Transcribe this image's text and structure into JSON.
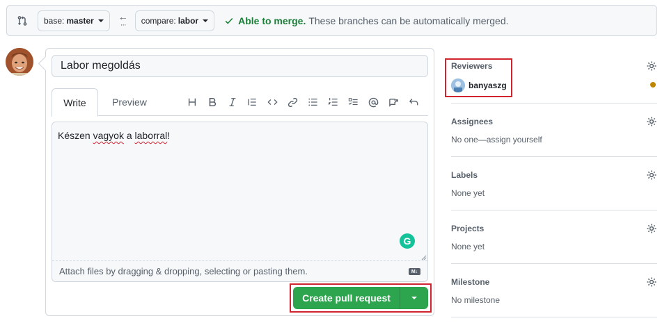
{
  "compare": {
    "base_prefix": "base:",
    "base_branch": "master",
    "compare_prefix": "compare:",
    "compare_branch": "labor",
    "merge_status": "Able to merge.",
    "merge_detail": "These branches can be automatically merged.",
    "status_color": "#1a7f37"
  },
  "pr": {
    "title_value": "Labor megoldás",
    "tabs": [
      "Write",
      "Preview"
    ],
    "toolbar_icons": [
      "heading-icon",
      "bold-icon",
      "italic-icon",
      "quote-icon",
      "code-icon",
      "link-icon",
      "unordered-list-icon",
      "ordered-list-icon",
      "task-list-icon",
      "mention-icon",
      "cross-reference-icon",
      "undo-icon"
    ],
    "body_prefix": "Készen ",
    "body_word1": "vagyok",
    "body_mid": " a ",
    "body_word2": "laborral",
    "body_suffix": "!",
    "attach_hint": "Attach files by dragging & dropping, selecting or pasting them.",
    "markdown_badge": "M↓",
    "submit_label": "Create pull request",
    "submit_color": "#2da44e"
  },
  "sidebar": {
    "reviewers_title": "Reviewers",
    "reviewer_name": "banyaszg",
    "assignees_title": "Assignees",
    "assignees_value": "No one—assign yourself",
    "labels_title": "Labels",
    "labels_value": "None yet",
    "projects_title": "Projects",
    "projects_value": "None yet",
    "milestone_title": "Milestone",
    "milestone_value": "No milestone"
  },
  "highlight_color": "#d1242f"
}
